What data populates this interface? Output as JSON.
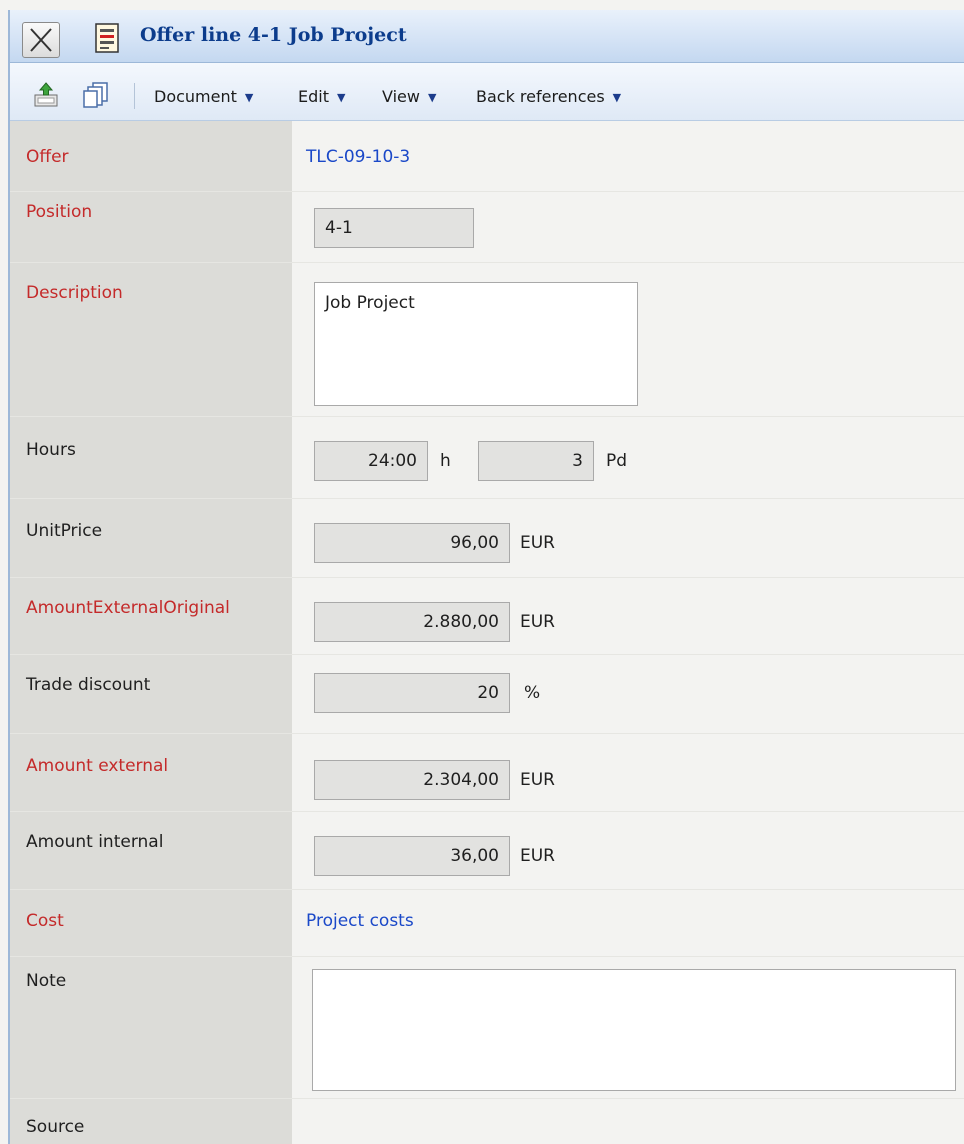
{
  "window": {
    "title": "Offer line 4-1 Job Project"
  },
  "toolbar": {
    "menus": [
      {
        "label": "Document"
      },
      {
        "label": "Edit"
      },
      {
        "label": "View"
      },
      {
        "label": "Back references"
      }
    ]
  },
  "form": {
    "offer": {
      "label": "Offer",
      "value": "TLC-09-10-3"
    },
    "position": {
      "label": "Position",
      "value": "4-1"
    },
    "description": {
      "label": "Description",
      "value": "Job Project"
    },
    "hours": {
      "label": "Hours",
      "hours_value": "24:00",
      "hours_unit": "h",
      "pd_value": "3",
      "pd_unit": "Pd"
    },
    "unit_price": {
      "label": "UnitPrice",
      "value": "96,00",
      "unit": "EUR"
    },
    "amount_external_original": {
      "label": "AmountExternalOriginal",
      "value": "2.880,00",
      "unit": "EUR"
    },
    "trade_discount": {
      "label": "Trade discount",
      "value": "20",
      "unit": "%"
    },
    "amount_external": {
      "label": "Amount external",
      "value": "2.304,00",
      "unit": "EUR"
    },
    "amount_internal": {
      "label": "Amount internal",
      "value": "36,00",
      "unit": "EUR"
    },
    "cost": {
      "label": "Cost",
      "value": "Project costs"
    },
    "note": {
      "label": "Note",
      "value": ""
    },
    "source": {
      "label": "Source"
    }
  },
  "colors": {
    "required_label": "#c42a2a",
    "link": "#1a48c8",
    "title": "#0c3c8c",
    "label_column": "#dcdcd8"
  },
  "icons": [
    "close-icon",
    "document-icon",
    "save-icon",
    "copy-icon",
    "dropdown-arrow-icon"
  ]
}
